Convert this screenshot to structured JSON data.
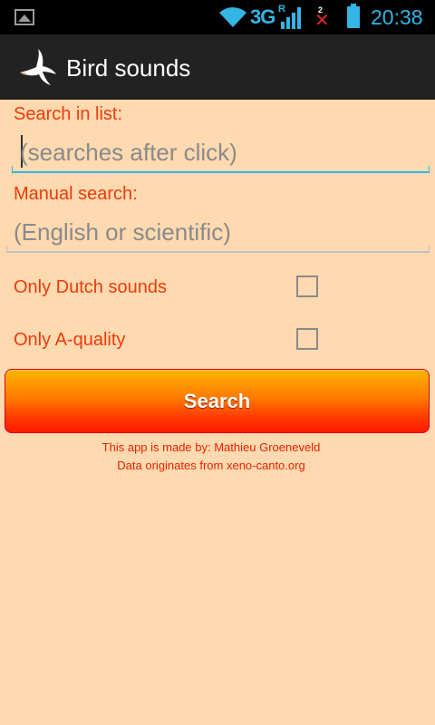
{
  "status_bar": {
    "network_type": "3G",
    "roaming": "R",
    "missed_count": "2",
    "missed_mark": "✕",
    "time": "20:38",
    "accent_color": "#33b5e5"
  },
  "action_bar": {
    "title": "Bird sounds",
    "icon": "flying-bird-icon"
  },
  "form": {
    "search_list_label": "Search in list:",
    "search_list_placeholder": "(searches after click)",
    "manual_search_label": "Manual search:",
    "manual_search_placeholder": "(English or scientific)",
    "only_dutch_label": "Only Dutch sounds",
    "only_dutch_checked": false,
    "only_a_quality_label": "Only A-quality",
    "only_a_quality_checked": false,
    "search_button": "Search"
  },
  "footer": {
    "made_by": "This app is made by: Mathieu Groeneveld",
    "data_source": "Data originates from xeno-canto.org"
  },
  "colors": {
    "background": "#ffd9b0",
    "label": "#ee3b0a",
    "button_top": "#ffb400",
    "button_bottom": "#ff1a00"
  }
}
